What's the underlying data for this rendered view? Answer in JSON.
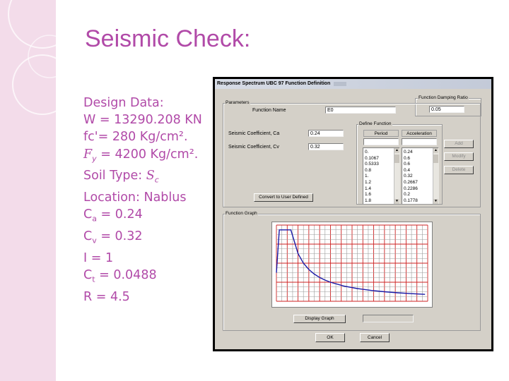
{
  "slide": {
    "title": "Seismic Check:",
    "accent_color": "#b14aa8",
    "design_data": [
      {
        "text": "Design Data:"
      },
      {
        "text": "W = 13290.208 KN"
      },
      {
        "text": "fc'= 280 Kg/cm²."
      },
      {
        "sym": "F",
        "sub": "y",
        "rest": " = 4200 Kg/cm²."
      },
      {
        "pre": "Soil Type: ",
        "sym": "S",
        "sub": "c"
      },
      {
        "text": "Location: Nablus"
      },
      {
        "sym": "C",
        "sub": "a",
        "rest": " = 0.24"
      },
      {
        "sym": "C",
        "sub": "v",
        "rest": " = 0.32"
      },
      {
        "text": "I = 1"
      },
      {
        "sym": "C",
        "sub": "t",
        "rest": " = 0.0488"
      },
      {
        "text": "R = 4.5"
      }
    ]
  },
  "dialog": {
    "title": "Response Spectrum UBC 97 Function Definition",
    "function_name_label": "Function Name",
    "function_name_value": "E0",
    "damping_group_label": "Function Damping Ratio",
    "damping_value": "0.05",
    "parameters_group_label": "Parameters",
    "seismic_ca_label": "Seismic Coefficient, Ca",
    "seismic_ca_value": "0.24",
    "seismic_cv_label": "Seismic Coefficient, Cv",
    "seismic_cv_value": "0.32",
    "define_function_label": "Define Function",
    "col_period": "Period",
    "col_acceleration": "Acceleration",
    "periods": [
      "0.",
      "0.1067",
      "0.5333",
      "0.8",
      "1.",
      "1.2",
      "1.4",
      "1.6",
      "1.8"
    ],
    "accelerations": [
      "0.24",
      "0.6",
      "0.6",
      "0.4",
      "0.32",
      "0.2667",
      "0.2286",
      "0.2",
      "0.1778"
    ],
    "add_button": "Add",
    "modify_button": "Modify",
    "delete_button": "Delete",
    "convert_button": "Convert to User Defined",
    "graph_group_label": "Function Graph",
    "display_graph_button": "Display Graph",
    "ok_button": "OK",
    "cancel_button": "Cancel",
    "colors": {
      "face": "#d4d0c8",
      "grid_red": "#cc2222",
      "grid_gray": "#9a9a9a",
      "curve": "#1a1aa8"
    }
  },
  "chart_data": {
    "type": "line",
    "title": "",
    "xlabel": "",
    "ylabel": "",
    "xlim": [
      0,
      5.6
    ],
    "ylim": [
      0,
      0.64
    ],
    "grid": true,
    "series": [
      {
        "x": [
          0,
          0.1067,
          0.5333,
          0.8,
          1.0,
          1.2,
          1.4,
          1.6,
          1.8,
          2.0,
          2.5,
          3.0,
          3.5,
          4.0,
          4.5,
          5.0,
          5.5
        ],
        "values": [
          0.24,
          0.6,
          0.6,
          0.4,
          0.32,
          0.2667,
          0.2286,
          0.2,
          0.1778,
          0.16,
          0.128,
          0.1067,
          0.0914,
          0.08,
          0.0711,
          0.064,
          0.0582
        ]
      }
    ]
  }
}
